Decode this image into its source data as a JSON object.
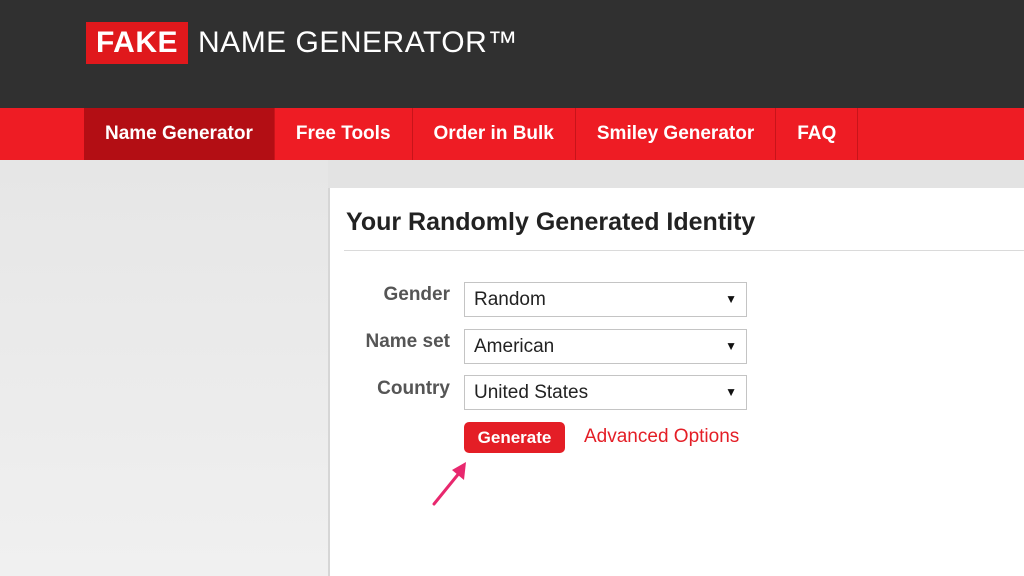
{
  "header": {
    "logo_fake": "FAKE",
    "logo_rest": "NAME GENERATOR™"
  },
  "nav": {
    "items": [
      {
        "label": "Name Generator",
        "active": true
      },
      {
        "label": "Free Tools"
      },
      {
        "label": "Order in Bulk"
      },
      {
        "label": "Smiley Generator"
      },
      {
        "label": "FAQ"
      }
    ]
  },
  "form": {
    "title": "Your Randomly Generated Identity",
    "gender_label": "Gender",
    "gender_value": "Random",
    "nameset_label": "Name set",
    "nameset_value": "American",
    "country_label": "Country",
    "country_value": "United States",
    "generate_label": "Generate",
    "advanced_label": "Advanced Options"
  },
  "colors": {
    "brand_red": "#ee1c24",
    "active_nav": "#b30e14",
    "header_dark": "#303030",
    "pointer_arrow": "#e8286e"
  },
  "icons": {
    "select_arrow": "dropdown-arrow-icon",
    "annotation": "pointer-arrow-icon"
  }
}
